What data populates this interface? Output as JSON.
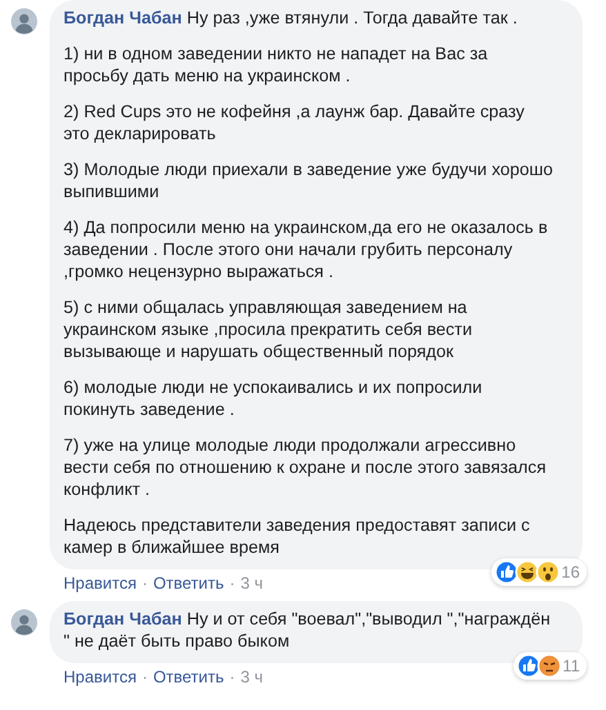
{
  "comments": [
    {
      "author": "Богдан Чабан",
      "paragraphs": [
        "Ну раз ,уже втянули . Тогда давайте так .",
        "1) ни в одном заведении никто не нападет на Вас за просьбу дать меню на украинском .",
        "2) Red Cups это не кофейня ,а лаунж бар. Давайте сразу это декларировать",
        "3) Молодые люди приехали в заведение уже будучи хорошо выпившими",
        "4) Да попросили меню на украинском,да его не оказалось в заведении . После этого они начали грубить персоналу ,громко нецензурно выражаться .",
        "5) с ними общалась управляющая заведением на украинском языке ,просила прекратить себя вести вызывающе и нарушать общественный порядок",
        "6) молодые люди не успокаивались и их попросили покинуть заведение .",
        "7) уже на улице молодые люди продолжали агрессивно вести себя по отношению к охране и после этого завязался конфликт .",
        "Надеюсь представители заведения предоставят записи с камер в ближайшее время"
      ],
      "reactions": {
        "icons": [
          {
            "kind": "like"
          },
          {
            "kind": "haha"
          },
          {
            "kind": "wow"
          }
        ],
        "count": "16"
      },
      "actions": [
        {
          "kind": "link",
          "label": "Нравится"
        },
        {
          "kind": "dot",
          "label": "·"
        },
        {
          "kind": "link",
          "label": "Ответить"
        },
        {
          "kind": "dot",
          "label": "·"
        },
        {
          "kind": "time",
          "label": "3 ч"
        }
      ]
    },
    {
      "author": "Богдан Чабан",
      "paragraphs": [
        "Ну и от себя \"воевал\",\"выводил \",\"награждён \" не даёт быть право быком"
      ],
      "reactions": {
        "icons": [
          {
            "kind": "like"
          },
          {
            "kind": "angry"
          }
        ],
        "count": "11"
      },
      "actions": [
        {
          "kind": "link",
          "label": "Нравится"
        },
        {
          "kind": "dot",
          "label": "·"
        },
        {
          "kind": "link",
          "label": "Ответить"
        },
        {
          "kind": "dot",
          "label": "·"
        },
        {
          "kind": "time",
          "label": "3 ч"
        }
      ]
    }
  ]
}
